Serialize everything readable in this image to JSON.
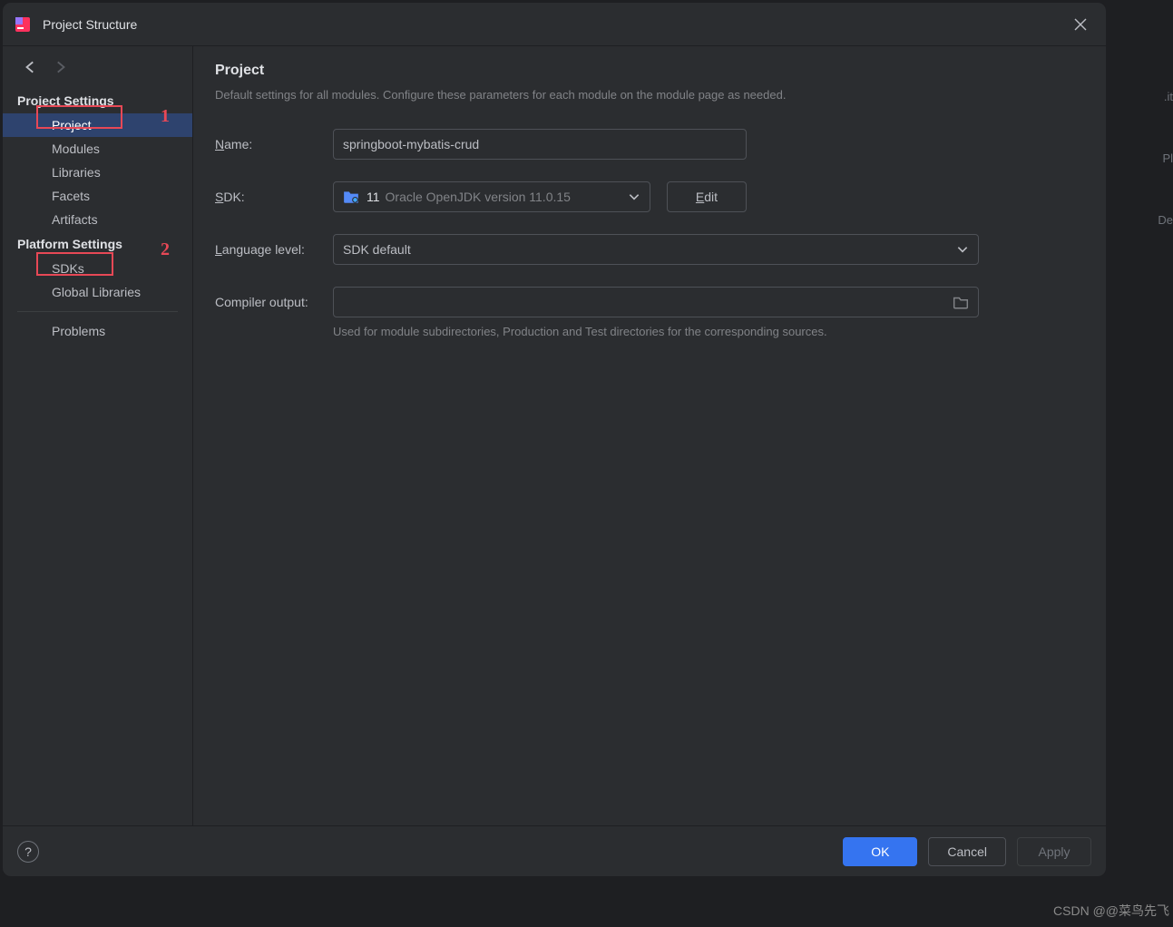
{
  "title": "Project Structure",
  "sidebar": {
    "sections": [
      {
        "header": "Project Settings",
        "items": [
          {
            "label": "Project",
            "selected": true
          },
          {
            "label": "Modules"
          },
          {
            "label": "Libraries"
          },
          {
            "label": "Facets"
          },
          {
            "label": "Artifacts"
          }
        ]
      },
      {
        "header": "Platform Settings",
        "items": [
          {
            "label": "SDKs"
          },
          {
            "label": "Global Libraries"
          }
        ]
      }
    ],
    "problems": "Problems"
  },
  "annotations": {
    "one": "1",
    "two": "2"
  },
  "content": {
    "title": "Project",
    "description": "Default settings for all modules. Configure these parameters for each module on the module page as needed.",
    "name_label": "Name:",
    "name_value": "springboot-mybatis-crud",
    "sdk_label": "SDK:",
    "sdk_version": "11",
    "sdk_detail": "Oracle OpenJDK version 11.0.15",
    "edit_label": "Edit",
    "lang_label": "Language level:",
    "lang_value": "SDK default",
    "compiler_label": "Compiler output:",
    "compiler_value": "",
    "compiler_hint": "Used for module subdirectories, Production and Test directories for the corresponding sources."
  },
  "footer": {
    "ok": "OK",
    "cancel": "Cancel",
    "apply": "Apply"
  },
  "watermark": "CSDN @@菜鸟先飞",
  "bg_fragments": [
    "",
    "",
    ".it",
    "",
    "Pl",
    "",
    "De"
  ]
}
